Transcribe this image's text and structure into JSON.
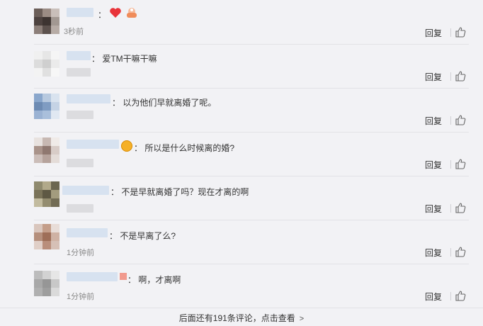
{
  "comments": [
    {
      "text": "：",
      "emoji": [
        "heart",
        "bowl"
      ],
      "time": "3秒前",
      "reply": "回复"
    },
    {
      "text": "：  爱TM干嘛干嘛",
      "time": "",
      "reply": "回复"
    },
    {
      "text": "：  以为他们早就离婚了呢。",
      "time": "",
      "reply": "回复"
    },
    {
      "text": "：  所以是什么时候离的婚?",
      "time": "",
      "reply": "回复"
    },
    {
      "text": "：  不是早就离婚了吗？现在才离的啊",
      "time": "",
      "reply": "回复"
    },
    {
      "text": "：  不是早离了么?",
      "time": "1分钟前",
      "reply": "回复"
    },
    {
      "text": "：  啊，才离啊",
      "time": "1分钟前",
      "reply": "回复"
    }
  ],
  "more_comments": "后面还有191条评论，点击查看",
  "icons": {
    "like": "thumbs-up-icon",
    "more": "chevron-right-icon"
  }
}
